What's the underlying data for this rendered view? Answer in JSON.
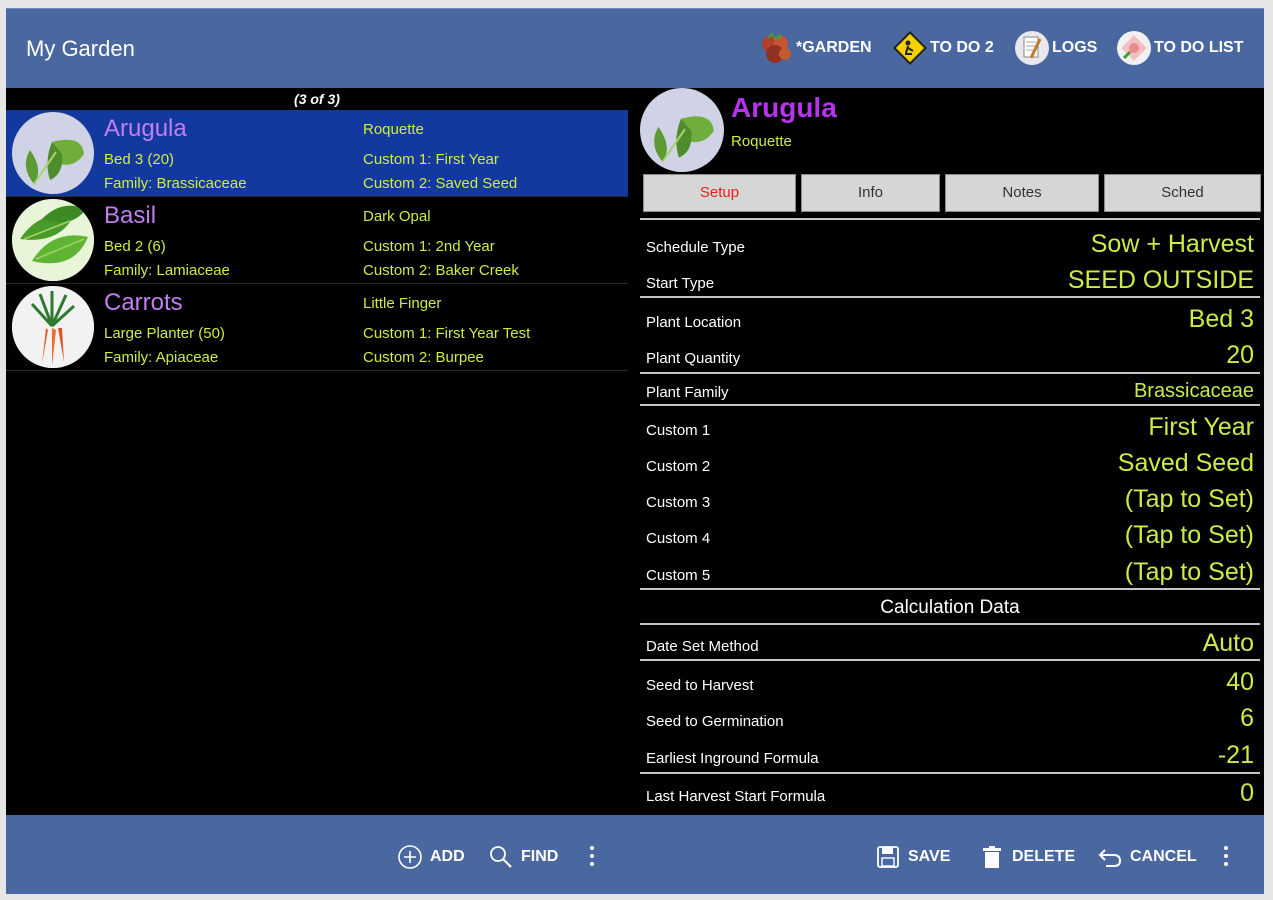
{
  "app": {
    "title": "My Garden"
  },
  "toolbar": {
    "actions": [
      {
        "label": "*GARDEN",
        "icon": "tomato-icon"
      },
      {
        "label": "TO DO 2",
        "icon": "gardener-sign-icon"
      },
      {
        "label": "LOGS",
        "icon": "notepad-icon"
      },
      {
        "label": "TO DO LIST",
        "icon": "flower-icon"
      }
    ]
  },
  "list": {
    "count": "(3 of 3)",
    "items": [
      {
        "name": "Arugula",
        "variety": "Roquette",
        "location": "Bed 3  (20)",
        "family": "Family: Brassicaceae",
        "custom1": "Custom 1: First Year",
        "custom2": "Custom 2: Saved Seed",
        "icon": "arugula-leaf-icon"
      },
      {
        "name": "Basil",
        "variety": "Dark Opal",
        "location": "Bed 2  (6)",
        "family": "Family: Lamiaceae",
        "custom1": "Custom 1: 2nd Year",
        "custom2": "Custom 2: Baker Creek",
        "icon": "basil-leaf-icon"
      },
      {
        "name": "Carrots",
        "variety": "Little Finger",
        "location": "Large Planter  (50)",
        "family": "Family: Apiaceae",
        "custom1": "Custom 1: First Year Test",
        "custom2": "Custom 2: Burpee",
        "icon": "carrot-icon"
      }
    ]
  },
  "detail": {
    "name": "Arugula",
    "variety": "Roquette",
    "tabs": [
      "Setup",
      "Info",
      "Notes",
      "Sched"
    ],
    "active_tab": "Setup",
    "fields": [
      {
        "label": "Schedule Type",
        "value": "Sow + Harvest"
      },
      {
        "label": "Start Type",
        "value": "SEED OUTSIDE"
      },
      {
        "label": "Plant Location",
        "value": "Bed 3"
      },
      {
        "label": "Plant Quantity",
        "value": "20"
      },
      {
        "label": "Plant Family",
        "value": "Brassicaceae"
      },
      {
        "label": "Custom 1",
        "value": "First Year"
      },
      {
        "label": "Custom 2",
        "value": "Saved Seed"
      },
      {
        "label": "Custom 3",
        "value": "(Tap to Set)"
      },
      {
        "label": "Custom 4",
        "value": "(Tap to Set)"
      },
      {
        "label": "Custom 5",
        "value": "(Tap to Set)"
      }
    ],
    "calc_header": "Calculation Data",
    "calc_fields": [
      {
        "label": "Date Set Method",
        "value": "Auto"
      },
      {
        "label": "Seed to Harvest",
        "value": "40"
      },
      {
        "label": "Seed to Germination",
        "value": "6"
      },
      {
        "label": "Earliest Inground Formula",
        "value": "-21"
      },
      {
        "label": "Last Harvest Start Formula",
        "value": "0"
      }
    ]
  },
  "bottombar": {
    "add_label": "ADD",
    "find_label": "FIND",
    "save_label": "SAVE",
    "delete_label": "DELETE",
    "cancel_label": "CANCEL"
  },
  "colors": {
    "bar": "#4a67a0",
    "selected_row": "#13399e",
    "plant_name": "#c07ff0",
    "detail_name": "#b733ee",
    "value_green": "#cdeb45",
    "active_tab": "#e8201c"
  }
}
